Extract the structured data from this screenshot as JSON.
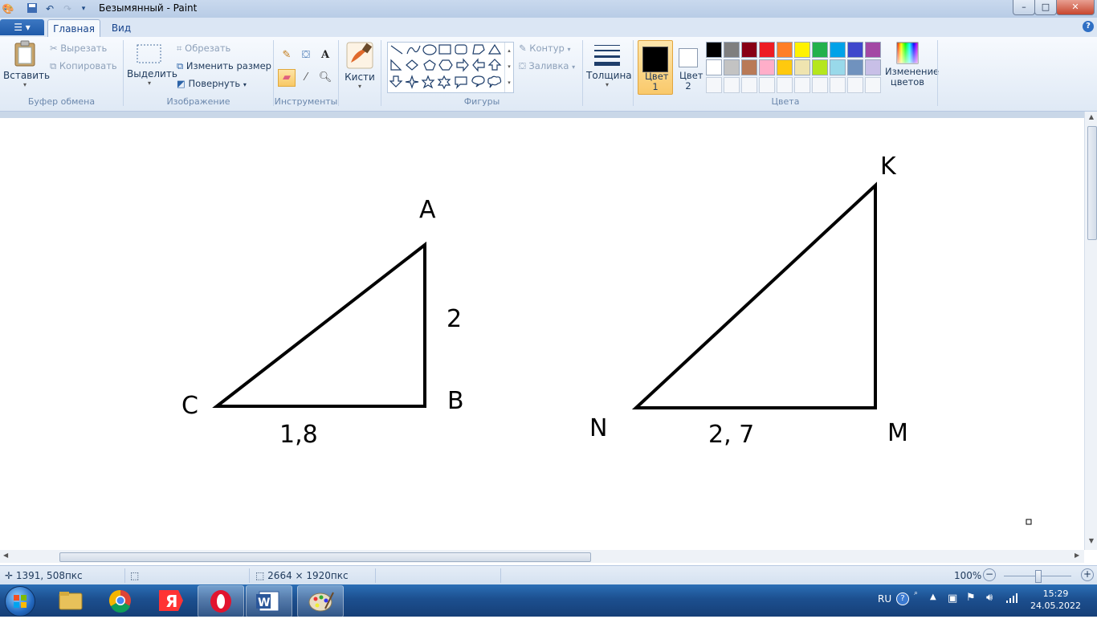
{
  "window": {
    "title": "Безымянный - Paint",
    "controls": [
      "minimize",
      "maximize",
      "close"
    ]
  },
  "tabs": {
    "file_menu_icon": "menu-icon",
    "home": "Главная",
    "view": "Вид"
  },
  "ribbon": {
    "clipboard": {
      "group_label": "Буфер обмена",
      "paste": "Вставить",
      "cut": "Вырезать",
      "copy": "Копировать"
    },
    "image": {
      "group_label": "Изображение",
      "select": "Выделить",
      "crop": "Обрезать",
      "resize": "Изменить размер",
      "rotate": "Повернуть"
    },
    "tools": {
      "group_label": "Инструменты",
      "items": [
        "pencil",
        "fill",
        "text",
        "eraser",
        "color-picker",
        "magnifier"
      ],
      "active": "eraser"
    },
    "brushes": {
      "label": "Кисти"
    },
    "shapes": {
      "group_label": "Фигуры",
      "outline": "Контур",
      "fill": "Заливка",
      "items": [
        "line",
        "curve",
        "oval",
        "rectangle",
        "rounded-rectangle",
        "polygon",
        "triangle",
        "right-triangle",
        "diamond",
        "pentagon",
        "hexagon",
        "arrow-right",
        "arrow-left",
        "arrow-up",
        "arrow-down",
        "star-4",
        "star-5",
        "star-6",
        "callout-rect",
        "callout-oval",
        "callout-cloud"
      ]
    },
    "size": {
      "label": "Толщина"
    },
    "colors": {
      "group_label": "Цвета",
      "color1_label": "Цвет 1",
      "color2_label": "Цвет 2",
      "color1": "#000000",
      "color2": "#ffffff",
      "edit_colors": "Изменение цветов",
      "palette_row1": [
        "#000000",
        "#7f7f7f",
        "#880015",
        "#ed1c24",
        "#ff7f27",
        "#fff200",
        "#22b14c",
        "#00a2e8",
        "#3f48cc",
        "#a349a4"
      ],
      "palette_row2": [
        "#ffffff",
        "#c3c3c3",
        "#b97a57",
        "#ffaec9",
        "#ffc90e",
        "#efe4b0",
        "#b5e61d",
        "#99d9ea",
        "#7092be",
        "#c8bfe7"
      ]
    }
  },
  "drawing": {
    "triangle1": {
      "labels": {
        "top": "A",
        "left": "C",
        "right": "B"
      },
      "side_vertical": "2",
      "side_bottom": "1,8"
    },
    "triangle2": {
      "labels": {
        "top": "K",
        "left": "N",
        "right": "M"
      },
      "side_bottom": "2, 7"
    }
  },
  "status_bar": {
    "cursor_pos": "1391, 508пкс",
    "image_size": "2664 × 1920пкс",
    "zoom": "100%"
  },
  "taskbar": {
    "apps": [
      "windows-start",
      "explorer",
      "chrome",
      "yandex-browser",
      "opera",
      "word",
      "paint"
    ],
    "language": "RU",
    "time": "15:29",
    "date": "24.05.2022"
  }
}
